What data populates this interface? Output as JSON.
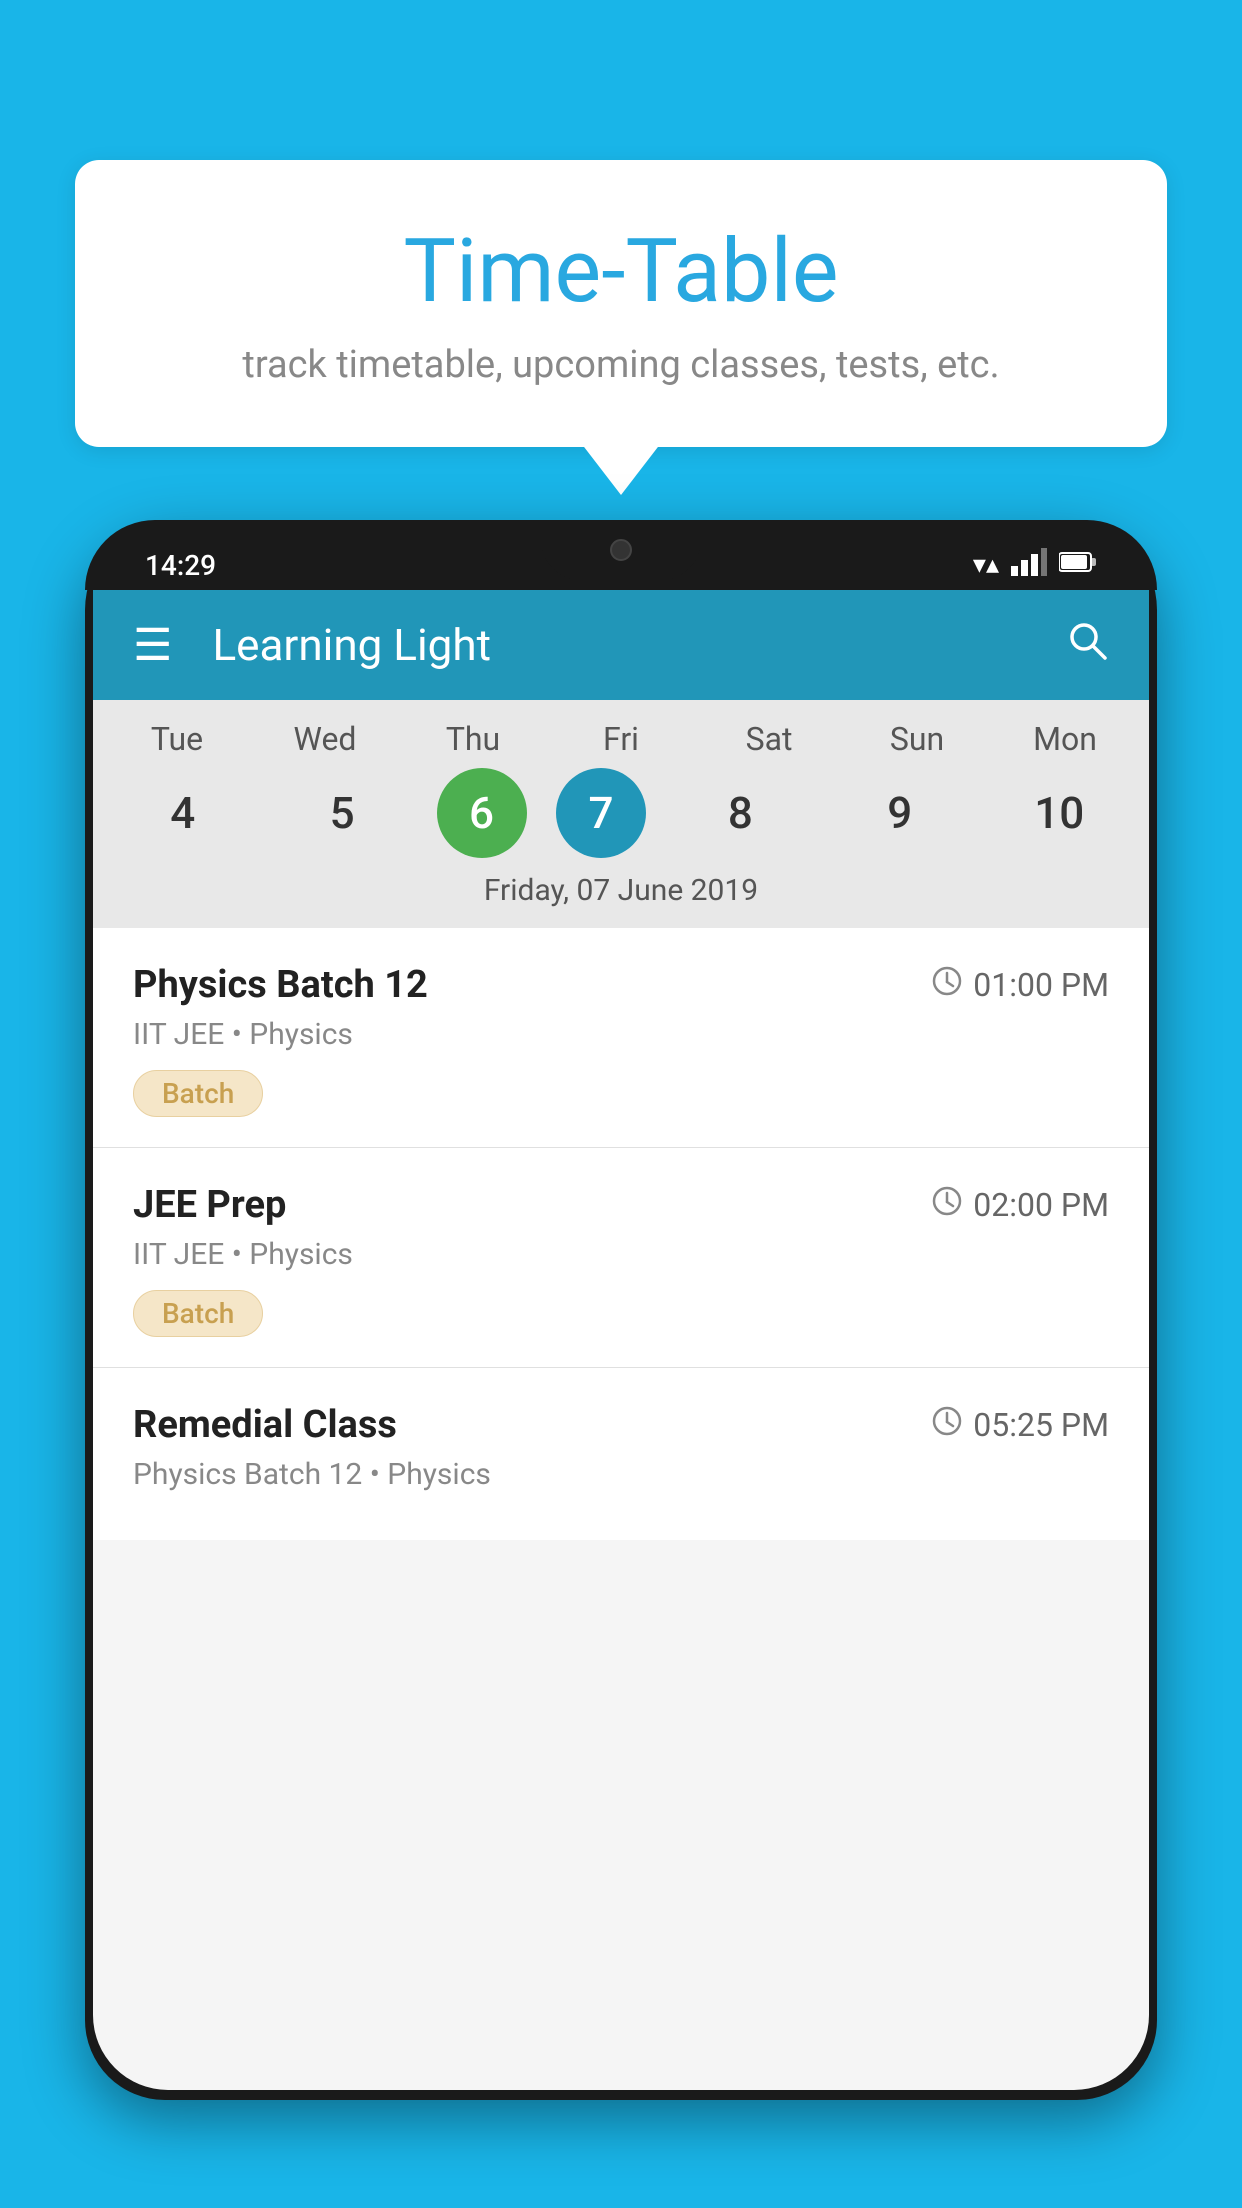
{
  "background_color": "#19b5e8",
  "speech_bubble": {
    "title": "Time-Table",
    "subtitle": "track timetable, upcoming classes, tests, etc."
  },
  "phone": {
    "status_bar": {
      "time": "14:29",
      "icons": [
        "wifi",
        "signal",
        "battery"
      ]
    },
    "app_bar": {
      "title": "Learning Light",
      "search_label": "search"
    },
    "calendar": {
      "days": [
        {
          "label": "Tue",
          "number": "4"
        },
        {
          "label": "Wed",
          "number": "5"
        },
        {
          "label": "Thu",
          "number": "6",
          "state": "today"
        },
        {
          "label": "Fri",
          "number": "7",
          "state": "selected"
        },
        {
          "label": "Sat",
          "number": "8"
        },
        {
          "label": "Sun",
          "number": "9"
        },
        {
          "label": "Mon",
          "number": "10"
        }
      ],
      "selected_date_label": "Friday, 07 June 2019"
    },
    "schedule_items": [
      {
        "title": "Physics Batch 12",
        "time": "01:00 PM",
        "subtitle": "IIT JEE • Physics",
        "tag": "Batch"
      },
      {
        "title": "JEE Prep",
        "time": "02:00 PM",
        "subtitle": "IIT JEE • Physics",
        "tag": "Batch"
      },
      {
        "title": "Remedial Class",
        "time": "05:25 PM",
        "subtitle": "Physics Batch 12 • Physics",
        "tag": null
      }
    ]
  }
}
